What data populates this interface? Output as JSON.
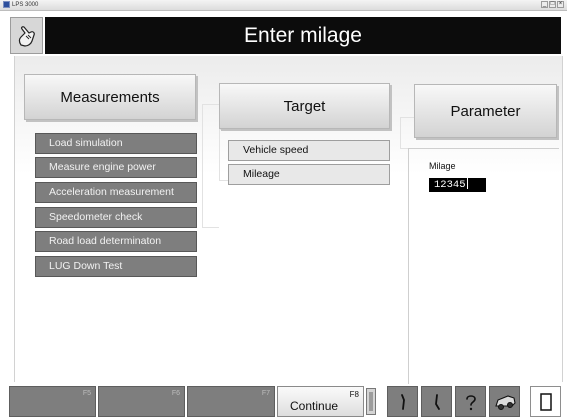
{
  "window": {
    "title": "LPS 3000",
    "buttons": {
      "minimize": "_",
      "maximize": "□",
      "close": "×"
    }
  },
  "header": {
    "title": "Enter milage",
    "back_icon": "hand-pointer-icon"
  },
  "tabs": {
    "measurements": "Measurements",
    "target": "Target",
    "parameter": "Parameter"
  },
  "measurements": [
    {
      "label": "Load simulation"
    },
    {
      "label": "Measure engine power"
    },
    {
      "label": "Acceleration measurement"
    },
    {
      "label": "Speedometer check"
    },
    {
      "label": "Road load determinaton"
    },
    {
      "label": "LUG Down Test"
    }
  ],
  "targets": [
    {
      "label": "Vehicle speed"
    },
    {
      "label": "Mileage"
    }
  ],
  "parameter": {
    "label": "Milage",
    "value": "12345"
  },
  "function_keys": [
    {
      "key": "F5",
      "label": ""
    },
    {
      "key": "F6",
      "label": ""
    },
    {
      "key": "F7",
      "label": ""
    },
    {
      "key": "F8",
      "label": "Continue"
    }
  ],
  "toolbar_icons": [
    "dial-up-icon",
    "dial-down-icon",
    "help-icon",
    "vehicle-icon",
    "page-icon"
  ],
  "colors": {
    "header_bg": "#0c0c0c",
    "button_dark": "#7e7e7e",
    "value_bg": "#000000"
  }
}
